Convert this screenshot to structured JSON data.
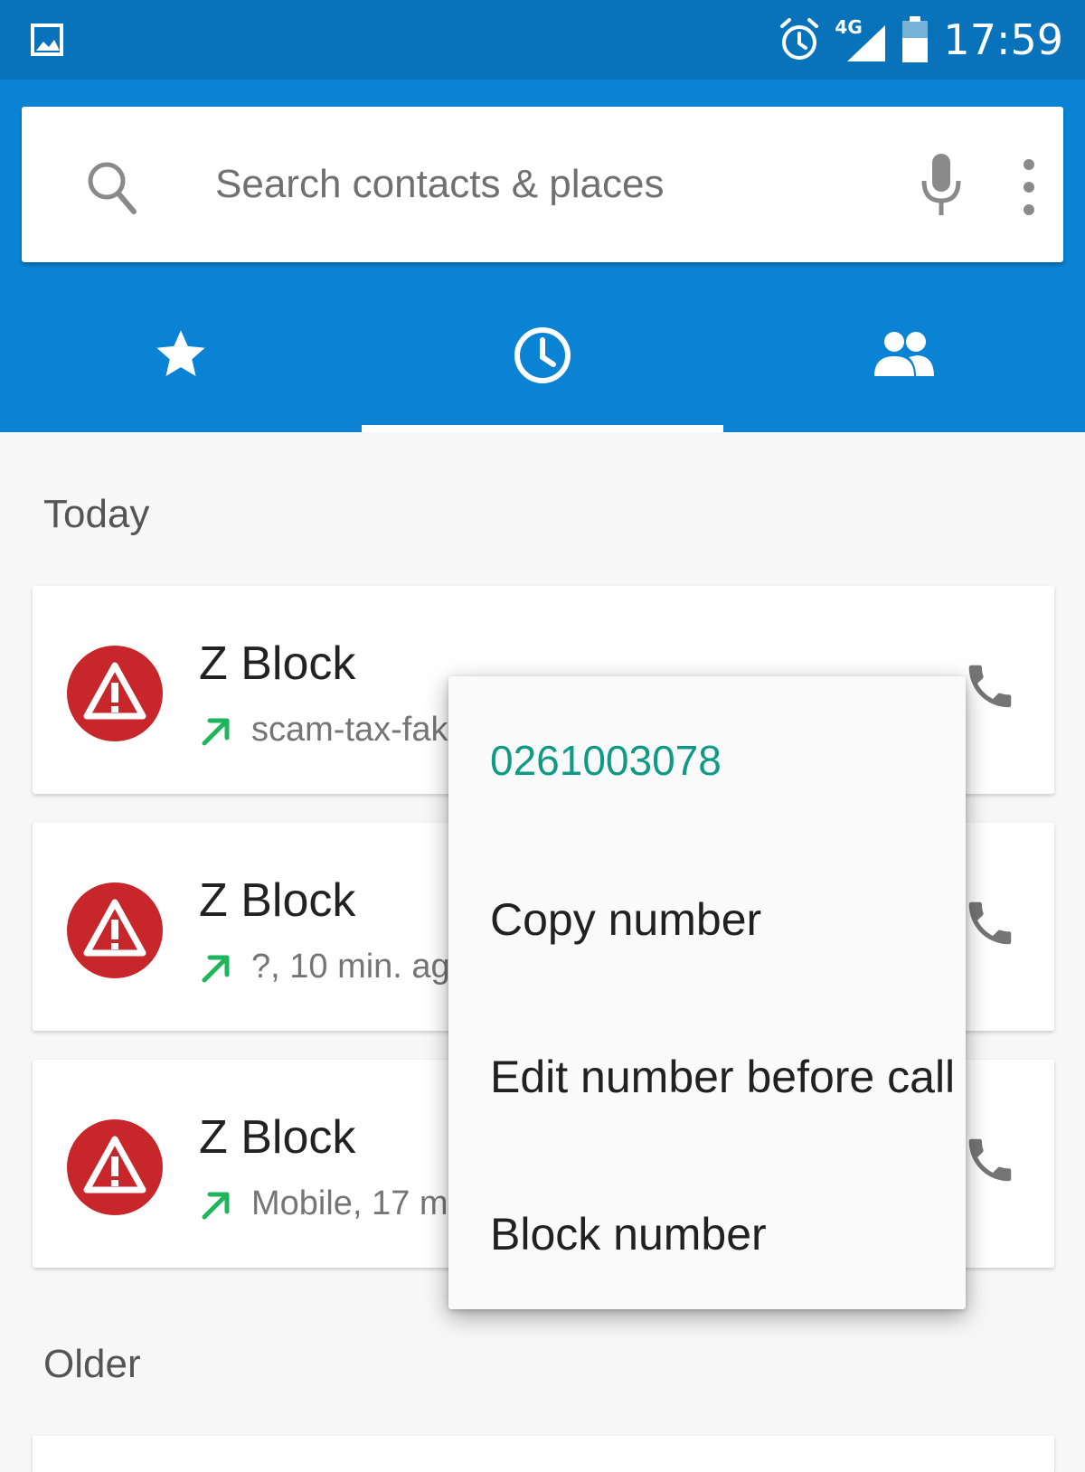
{
  "status_bar": {
    "network": "4G",
    "time": "17:59"
  },
  "search": {
    "placeholder": "Search contacts & places"
  },
  "tabs": [
    {
      "name": "favorites",
      "icon": "star-icon"
    },
    {
      "name": "recents",
      "icon": "clock-icon",
      "selected": true
    },
    {
      "name": "contacts",
      "icon": "people-icon"
    }
  ],
  "sections": {
    "today": "Today",
    "older": "Older"
  },
  "calls": [
    {
      "name": "Z Block",
      "detail": "scam-tax-fake,"
    },
    {
      "name": "Z Block",
      "detail": "?, 10 min. ago"
    },
    {
      "name": "Z Block",
      "detail": "Mobile, 17 min"
    }
  ],
  "popup": {
    "number": "0261003078",
    "items": [
      "Copy number",
      "Edit number before call",
      "Block number"
    ]
  },
  "colors": {
    "app_bar": "#0a83d4",
    "status_bar": "#0873ba",
    "accent_teal": "#0f9a86",
    "outgoing_green": "#1fb55a",
    "avatar_red": "#c7272b"
  }
}
